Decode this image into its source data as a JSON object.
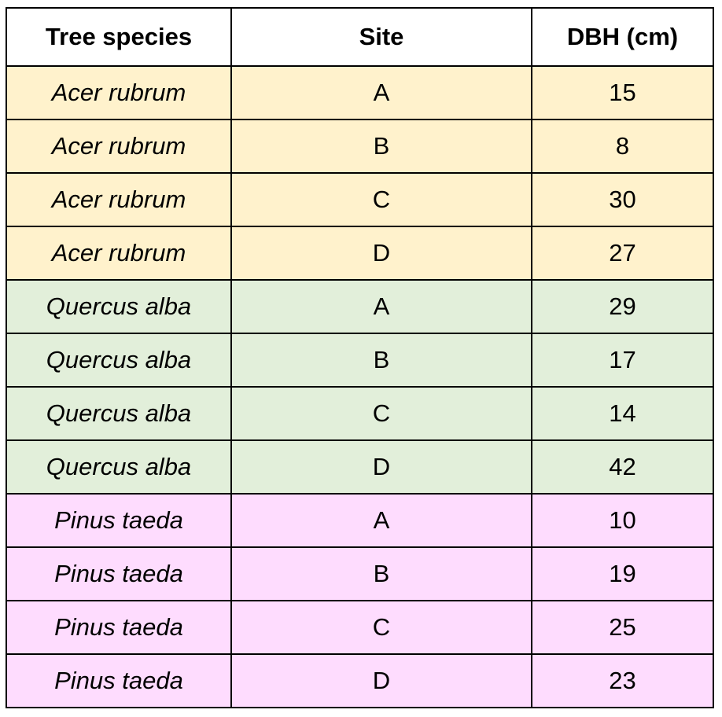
{
  "table": {
    "headers": [
      "Tree species",
      "Site",
      "DBH (cm)"
    ],
    "group_colors": {
      "Acer rubrum": "#fff2cc",
      "Quercus alba": "#e2efda",
      "Pinus taeda": "#fedcfe"
    },
    "rows": [
      {
        "species": "Acer rubrum",
        "site": "A",
        "dbh": "15"
      },
      {
        "species": "Acer rubrum",
        "site": "B",
        "dbh": "8"
      },
      {
        "species": "Acer rubrum",
        "site": "C",
        "dbh": "30"
      },
      {
        "species": "Acer rubrum",
        "site": "D",
        "dbh": "27"
      },
      {
        "species": "Quercus alba",
        "site": "A",
        "dbh": "29"
      },
      {
        "species": "Quercus alba",
        "site": "B",
        "dbh": "17"
      },
      {
        "species": "Quercus alba",
        "site": "C",
        "dbh": "14"
      },
      {
        "species": "Quercus alba",
        "site": "D",
        "dbh": "42"
      },
      {
        "species": "Pinus taeda",
        "site": "A",
        "dbh": "10"
      },
      {
        "species": "Pinus taeda",
        "site": "B",
        "dbh": "19"
      },
      {
        "species": "Pinus taeda",
        "site": "C",
        "dbh": "25"
      },
      {
        "species": "Pinus taeda",
        "site": "D",
        "dbh": "23"
      }
    ]
  }
}
